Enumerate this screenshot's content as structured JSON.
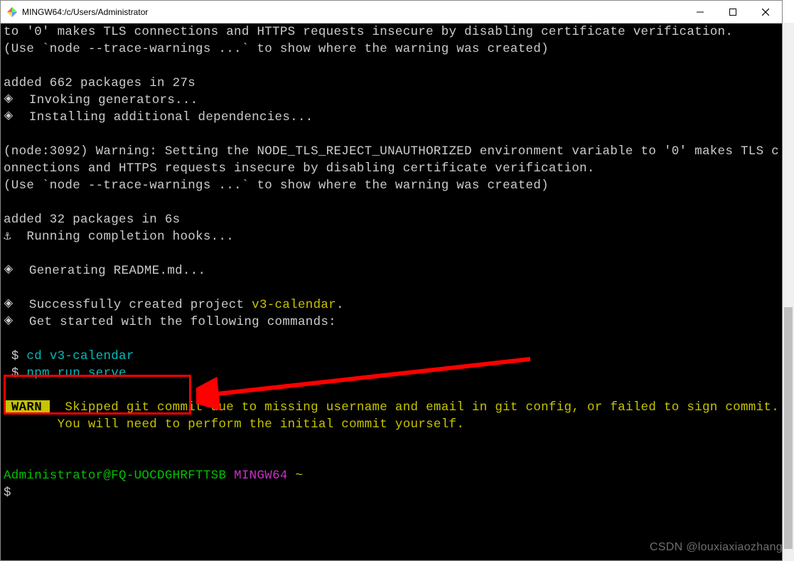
{
  "window": {
    "title": "MINGW64:/c/Users/Administrator"
  },
  "term": {
    "l0": "to '0' makes TLS connections and HTTPS requests insecure by disabling certificate verification.",
    "l1": "(Use `node --trace-warnings ...` to show where the warning was created)",
    "l2": "",
    "l3": "added 662 packages in 27s",
    "l4": "🞛  Invoking generators...",
    "l5": "🞛  Installing additional dependencies...",
    "l6": "",
    "l7": "(node:3092) Warning: Setting the NODE_TLS_REJECT_UNAUTHORIZED environment variable to '0' makes TLS connections and HTTPS requests insecure by disabling certificate verification.",
    "l8": "(Use `node --trace-warnings ...` to show where the warning was created)",
    "l9": "",
    "l10": "added 32 packages in 6s",
    "l11": "⚓  Running completion hooks...",
    "l12": "",
    "l13": "🞛  Generating README.md...",
    "l14": "",
    "l15_a": "🞛  Successfully created project ",
    "l15_b": "v3-calendar",
    "l15_c": ".",
    "l16": "🞛  Get started with the following commands:",
    "l17": "",
    "l18_a": " $ ",
    "l18_b": "cd v3-calendar",
    "l19_a": " $ ",
    "l19_b": "npm run serve",
    "l20": "",
    "warn_badge": " WARN ",
    "l21": "  Skipped git commit due to missing username and email in git config, or failed to sign commit.",
    "l22": "       You will need to perform the initial commit yourself.",
    "l23": "",
    "l24": "",
    "prompt_user": "Administrator@FQ-UOCDGHRFTTSB",
    "prompt_mid": " ",
    "prompt_env": "MINGW64",
    "prompt_path": " ~",
    "prompt_dollar": "$"
  },
  "watermark": "CSDN @louxiaxiaozhang"
}
